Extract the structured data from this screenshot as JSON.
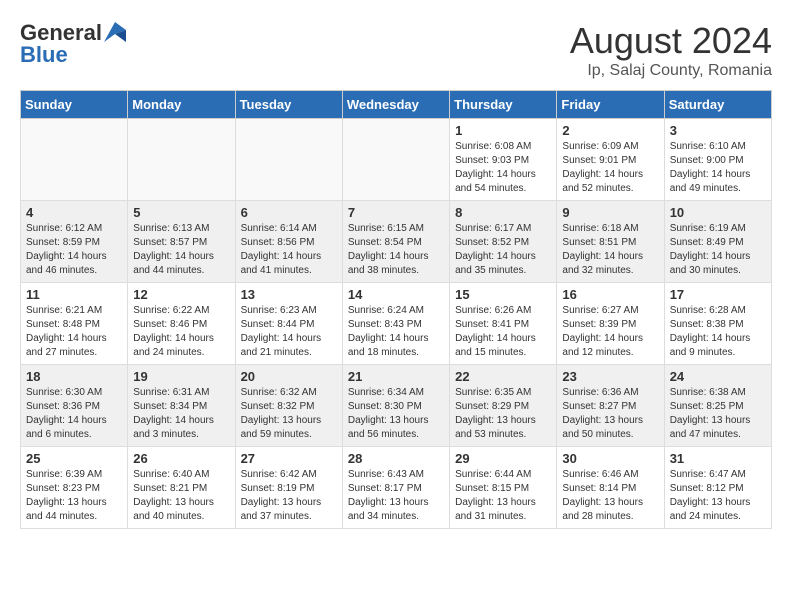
{
  "header": {
    "logo_general": "General",
    "logo_blue": "Blue",
    "month_year": "August 2024",
    "location": "Ip, Salaj County, Romania"
  },
  "days_of_week": [
    "Sunday",
    "Monday",
    "Tuesday",
    "Wednesday",
    "Thursday",
    "Friday",
    "Saturday"
  ],
  "weeks": [
    [
      {
        "day": "",
        "info": ""
      },
      {
        "day": "",
        "info": ""
      },
      {
        "day": "",
        "info": ""
      },
      {
        "day": "",
        "info": ""
      },
      {
        "day": "1",
        "info": "Sunrise: 6:08 AM\nSunset: 9:03 PM\nDaylight: 14 hours\nand 54 minutes."
      },
      {
        "day": "2",
        "info": "Sunrise: 6:09 AM\nSunset: 9:01 PM\nDaylight: 14 hours\nand 52 minutes."
      },
      {
        "day": "3",
        "info": "Sunrise: 6:10 AM\nSunset: 9:00 PM\nDaylight: 14 hours\nand 49 minutes."
      }
    ],
    [
      {
        "day": "4",
        "info": "Sunrise: 6:12 AM\nSunset: 8:59 PM\nDaylight: 14 hours\nand 46 minutes."
      },
      {
        "day": "5",
        "info": "Sunrise: 6:13 AM\nSunset: 8:57 PM\nDaylight: 14 hours\nand 44 minutes."
      },
      {
        "day": "6",
        "info": "Sunrise: 6:14 AM\nSunset: 8:56 PM\nDaylight: 14 hours\nand 41 minutes."
      },
      {
        "day": "7",
        "info": "Sunrise: 6:15 AM\nSunset: 8:54 PM\nDaylight: 14 hours\nand 38 minutes."
      },
      {
        "day": "8",
        "info": "Sunrise: 6:17 AM\nSunset: 8:52 PM\nDaylight: 14 hours\nand 35 minutes."
      },
      {
        "day": "9",
        "info": "Sunrise: 6:18 AM\nSunset: 8:51 PM\nDaylight: 14 hours\nand 32 minutes."
      },
      {
        "day": "10",
        "info": "Sunrise: 6:19 AM\nSunset: 8:49 PM\nDaylight: 14 hours\nand 30 minutes."
      }
    ],
    [
      {
        "day": "11",
        "info": "Sunrise: 6:21 AM\nSunset: 8:48 PM\nDaylight: 14 hours\nand 27 minutes."
      },
      {
        "day": "12",
        "info": "Sunrise: 6:22 AM\nSunset: 8:46 PM\nDaylight: 14 hours\nand 24 minutes."
      },
      {
        "day": "13",
        "info": "Sunrise: 6:23 AM\nSunset: 8:44 PM\nDaylight: 14 hours\nand 21 minutes."
      },
      {
        "day": "14",
        "info": "Sunrise: 6:24 AM\nSunset: 8:43 PM\nDaylight: 14 hours\nand 18 minutes."
      },
      {
        "day": "15",
        "info": "Sunrise: 6:26 AM\nSunset: 8:41 PM\nDaylight: 14 hours\nand 15 minutes."
      },
      {
        "day": "16",
        "info": "Sunrise: 6:27 AM\nSunset: 8:39 PM\nDaylight: 14 hours\nand 12 minutes."
      },
      {
        "day": "17",
        "info": "Sunrise: 6:28 AM\nSunset: 8:38 PM\nDaylight: 14 hours\nand 9 minutes."
      }
    ],
    [
      {
        "day": "18",
        "info": "Sunrise: 6:30 AM\nSunset: 8:36 PM\nDaylight: 14 hours\nand 6 minutes."
      },
      {
        "day": "19",
        "info": "Sunrise: 6:31 AM\nSunset: 8:34 PM\nDaylight: 14 hours\nand 3 minutes."
      },
      {
        "day": "20",
        "info": "Sunrise: 6:32 AM\nSunset: 8:32 PM\nDaylight: 13 hours\nand 59 minutes."
      },
      {
        "day": "21",
        "info": "Sunrise: 6:34 AM\nSunset: 8:30 PM\nDaylight: 13 hours\nand 56 minutes."
      },
      {
        "day": "22",
        "info": "Sunrise: 6:35 AM\nSunset: 8:29 PM\nDaylight: 13 hours\nand 53 minutes."
      },
      {
        "day": "23",
        "info": "Sunrise: 6:36 AM\nSunset: 8:27 PM\nDaylight: 13 hours\nand 50 minutes."
      },
      {
        "day": "24",
        "info": "Sunrise: 6:38 AM\nSunset: 8:25 PM\nDaylight: 13 hours\nand 47 minutes."
      }
    ],
    [
      {
        "day": "25",
        "info": "Sunrise: 6:39 AM\nSunset: 8:23 PM\nDaylight: 13 hours\nand 44 minutes."
      },
      {
        "day": "26",
        "info": "Sunrise: 6:40 AM\nSunset: 8:21 PM\nDaylight: 13 hours\nand 40 minutes."
      },
      {
        "day": "27",
        "info": "Sunrise: 6:42 AM\nSunset: 8:19 PM\nDaylight: 13 hours\nand 37 minutes."
      },
      {
        "day": "28",
        "info": "Sunrise: 6:43 AM\nSunset: 8:17 PM\nDaylight: 13 hours\nand 34 minutes."
      },
      {
        "day": "29",
        "info": "Sunrise: 6:44 AM\nSunset: 8:15 PM\nDaylight: 13 hours\nand 31 minutes."
      },
      {
        "day": "30",
        "info": "Sunrise: 6:46 AM\nSunset: 8:14 PM\nDaylight: 13 hours\nand 28 minutes."
      },
      {
        "day": "31",
        "info": "Sunrise: 6:47 AM\nSunset: 8:12 PM\nDaylight: 13 hours\nand 24 minutes."
      }
    ]
  ]
}
